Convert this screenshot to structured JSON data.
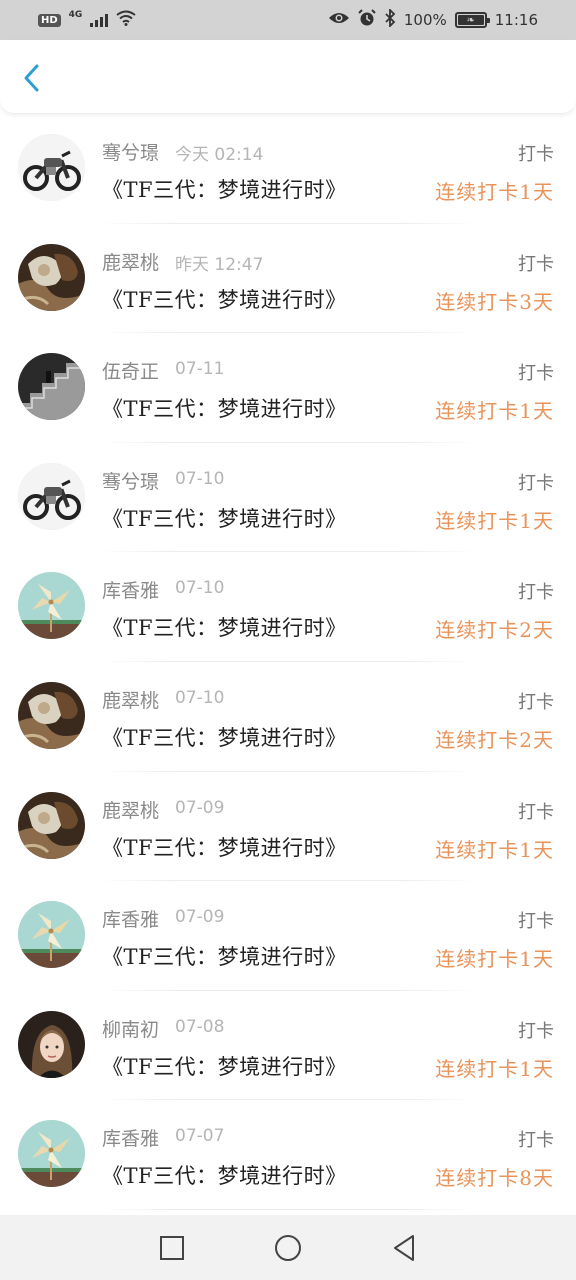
{
  "status_bar": {
    "hd": "HD",
    "network": "4G",
    "battery_text": "100%",
    "time": "11:16",
    "icons": [
      "signal-icon",
      "wifi-icon",
      "eye-icon",
      "alarm-icon",
      "bluetooth-icon",
      "battery-icon"
    ]
  },
  "nav": {
    "back_icon": "chevron-left-icon",
    "accent": "#2a9fd6"
  },
  "colors": {
    "streak": "#e8935a",
    "name": "#8a8a8a",
    "time": "#b5b5b5"
  },
  "items": [
    {
      "name": "骞兮璟",
      "time": "今天 02:14",
      "title": "《TF三代：梦境进行时》",
      "action": "打卡",
      "streak": "连续打卡1天",
      "avatar": "motorcycle"
    },
    {
      "name": "鹿翠桃",
      "time": "昨天 12:47",
      "title": "《TF三代：梦境进行时》",
      "action": "打卡",
      "streak": "连续打卡3天",
      "avatar": "painting"
    },
    {
      "name": "伍奇正",
      "time": "07-11",
      "title": "《TF三代：梦境进行时》",
      "action": "打卡",
      "streak": "连续打卡1天",
      "avatar": "stairs"
    },
    {
      "name": "骞兮璟",
      "time": "07-10",
      "title": "《TF三代：梦境进行时》",
      "action": "打卡",
      "streak": "连续打卡1天",
      "avatar": "motorcycle"
    },
    {
      "name": "库香雅",
      "time": "07-10",
      "title": "《TF三代：梦境进行时》",
      "action": "打卡",
      "streak": "连续打卡2天",
      "avatar": "pinwheel"
    },
    {
      "name": "鹿翠桃",
      "time": "07-10",
      "title": "《TF三代：梦境进行时》",
      "action": "打卡",
      "streak": "连续打卡2天",
      "avatar": "painting"
    },
    {
      "name": "鹿翠桃",
      "time": "07-09",
      "title": "《TF三代：梦境进行时》",
      "action": "打卡",
      "streak": "连续打卡1天",
      "avatar": "painting"
    },
    {
      "name": "库香雅",
      "time": "07-09",
      "title": "《TF三代：梦境进行时》",
      "action": "打卡",
      "streak": "连续打卡1天",
      "avatar": "pinwheel"
    },
    {
      "name": "柳南初",
      "time": "07-08",
      "title": "《TF三代：梦境进行时》",
      "action": "打卡",
      "streak": "连续打卡1天",
      "avatar": "portrait"
    },
    {
      "name": "库香雅",
      "time": "07-07",
      "title": "《TF三代：梦境进行时》",
      "action": "打卡",
      "streak": "连续打卡8天",
      "avatar": "pinwheel"
    }
  ],
  "system_nav": {
    "icons": [
      "recent-apps-icon",
      "home-icon",
      "back-icon"
    ]
  }
}
